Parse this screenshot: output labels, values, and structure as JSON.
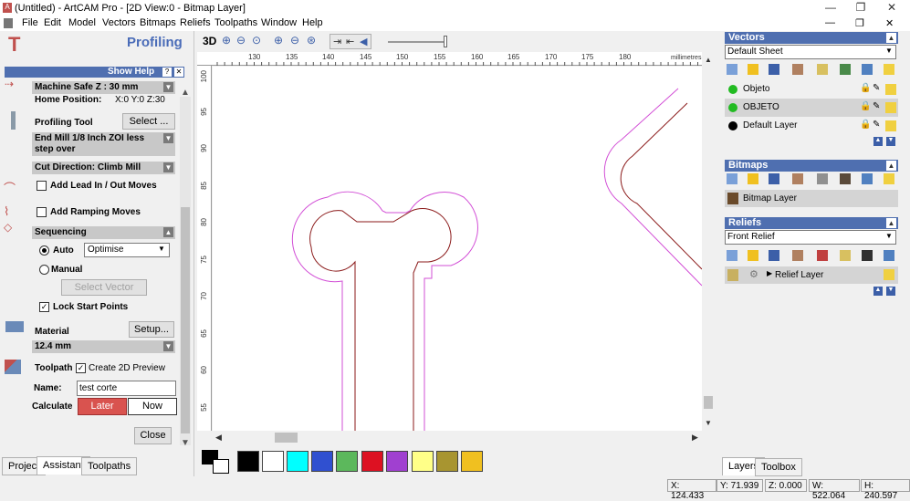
{
  "window": {
    "title": "(Untitled) - ArtCAM Pro - [2D View:0 - Bitmap Layer]"
  },
  "menu": [
    "File",
    "Edit",
    "Model",
    "Vectors",
    "Bitmaps",
    "Reliefs",
    "Toolpaths",
    "Window",
    "Help"
  ],
  "left": {
    "title": "Profiling",
    "show_help": "Show Help",
    "safe_z_label": "Machine Safe Z : 30 mm",
    "home_label": "Home Position:",
    "home_value": "X:0 Y:0 Z:30",
    "tool_label": "Profiling Tool",
    "select_btn": "Select ...",
    "tool_name": "End Mill 1/8 Inch ZOI less step over",
    "cut_dir": "Cut Direction: Climb Mill",
    "lead": "Add Lead In / Out Moves",
    "ramp": "Add Ramping Moves",
    "sequencing": "Sequencing",
    "auto": "Auto",
    "optimise": "Optimise",
    "manual": "Manual",
    "select_vector": "Select Vector",
    "lock_start": "Lock Start Points",
    "material": "Material",
    "setup": "Setup...",
    "thickness": "12.4 mm",
    "toolpath": "Toolpath",
    "create_preview": "Create 2D Preview",
    "name_label": "Name:",
    "name_value": "test corte",
    "calculate": "Calculate",
    "later": "Later",
    "now": "Now",
    "close": "Close",
    "tabs": [
      "Project",
      "Assistant",
      "Toolpaths"
    ]
  },
  "toolbar": {
    "three_d": "3D"
  },
  "ruler": {
    "x_labels": [
      "130",
      "135",
      "140",
      "145",
      "150",
      "155",
      "160",
      "165",
      "170",
      "175",
      "180"
    ],
    "y_labels": [
      "100",
      "95",
      "90",
      "85",
      "80",
      "75",
      "70",
      "65",
      "60",
      "55"
    ],
    "units": "millimetres"
  },
  "palette": [
    "#000000",
    "#ffffff",
    "#00ffff",
    "#3050d0",
    "#5cb85c",
    "#dd1122",
    "#a040d0",
    "#ffff88",
    "#a89530",
    "#f0c020"
  ],
  "right": {
    "vectors_header": "Vectors",
    "default_sheet": "Default Sheet",
    "layers": [
      {
        "name": "Objeto",
        "color": "#22bb22"
      },
      {
        "name": "OBJETO",
        "color": "#22bb22"
      },
      {
        "name": "Default Layer",
        "color": "#000000"
      }
    ],
    "bitmaps_header": "Bitmaps",
    "bitmap_layer": "Bitmap Layer",
    "reliefs_header": "Reliefs",
    "front_relief": "Front Relief",
    "relief_layer": "Relief Layer",
    "tabs": [
      "Layers",
      "Toolbox"
    ]
  },
  "status": {
    "x": "X: 124.433",
    "y": "Y: 71.939",
    "z": "Z: 0.000",
    "w": "W: 522.064",
    "h": "H: 240.597"
  }
}
